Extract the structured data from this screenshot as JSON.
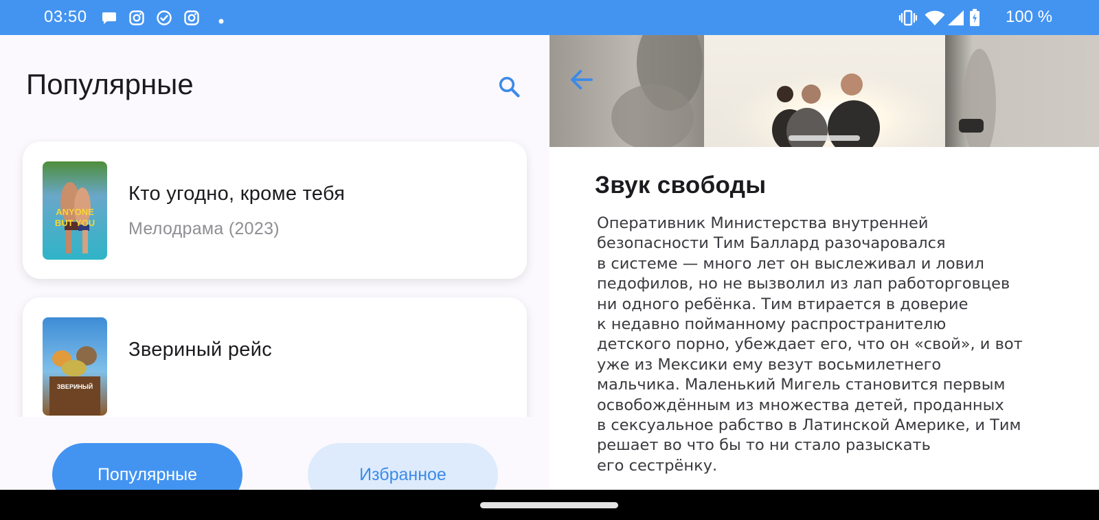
{
  "status_bar": {
    "time": "03:50",
    "notification_icons": [
      "chat-bubble-icon",
      "instagram-icon",
      "check-circle-icon",
      "instagram-icon",
      "dot-icon"
    ],
    "system_icons": [
      "vibrate-icon",
      "wifi-icon",
      "signal-icon",
      "battery-charging-icon"
    ],
    "battery_text": "100 %"
  },
  "left": {
    "title": "Популярные",
    "search_icon": "search-icon",
    "movies": [
      {
        "title": "Кто угодно, кроме тебя",
        "meta": "Мелодрама (2023)",
        "poster_text": "ANYONE BUT YOU"
      },
      {
        "title": "Звериный рейс",
        "meta": "",
        "poster_text": "ЗВЕРИНЫЙ РЕЙС"
      }
    ],
    "nav": {
      "popular_label": "Популярные",
      "favorites_label": "Избранное"
    }
  },
  "right": {
    "back_icon": "arrow-back-icon",
    "title": "Звук свободы",
    "description": "Оперативник Министерства внутренней\nбезопасности Тим Баллард разочаровался\nв системе — много лет он выслеживал и ловил\nпедофилов, но не вызволил из лап работорговцев\nни одного ребёнка. Тим втирается в доверие\nк недавно пойманному распространителю\nдетского порно, убеждает его, что он «свой», и вот\nуже из Мексики ему везут восьмилетнего\nмальчика. Маленький Мигель становится первым\nосвобождённым из множества детей, проданных\nв сексуальное рабство в Латинской Америке, и Тим\nрешает во что бы то ни стало разыскать\nего сестрёнку."
  },
  "colors": {
    "accent": "#4394F1",
    "accent_light": "#DDEBFC",
    "text_primary": "#1B1B1F",
    "text_secondary": "#8E8E93"
  }
}
